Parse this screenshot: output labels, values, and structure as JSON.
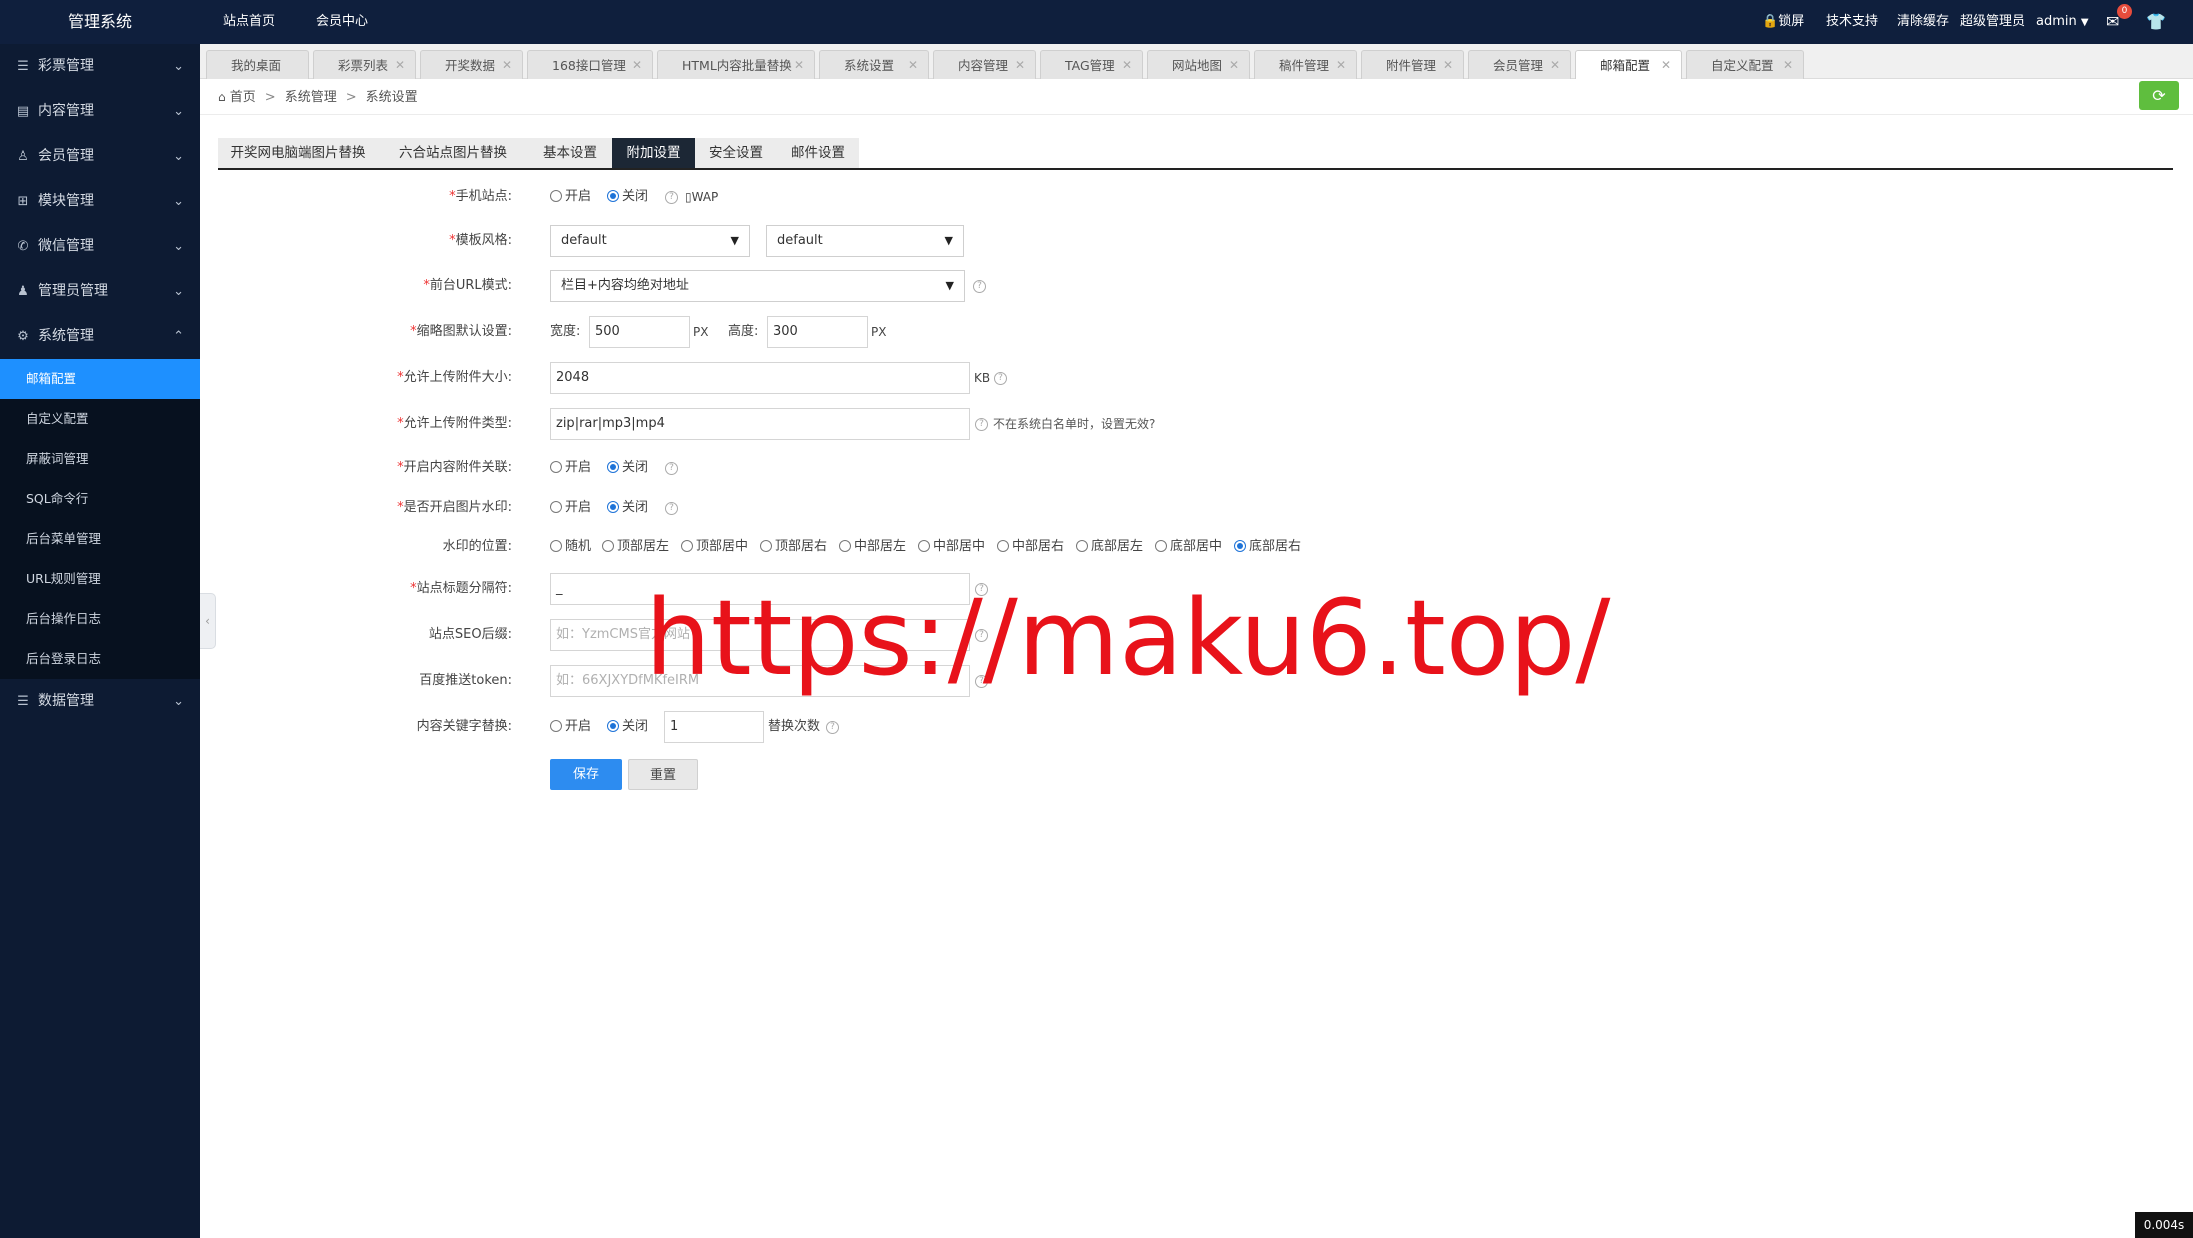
{
  "app": {
    "title": "管理系统"
  },
  "topnav": [
    "站点首页",
    "会员中心"
  ],
  "topright": {
    "lock": "锁屏",
    "support": "技术支持",
    "clear_cache": "清除缓存",
    "role": "超级管理员",
    "user": "admin",
    "mail_badge": "0"
  },
  "sidebar": {
    "groups": [
      "彩票管理",
      "内容管理",
      "会员管理",
      "模块管理",
      "微信管理",
      "管理员管理",
      "系统管理"
    ],
    "system_items": [
      "邮箱配置",
      "自定义配置",
      "屏蔽词管理",
      "SQL命令行",
      "后台菜单管理",
      "URL规则管理",
      "后台操作日志",
      "后台登录日志"
    ],
    "last_group": "数据管理"
  },
  "tabs": [
    "我的桌面",
    "彩票列表",
    "开奖数据",
    "168接口管理",
    "HTML内容批量替换",
    "系统设置",
    "内容管理",
    "TAG管理",
    "网站地图",
    "稿件管理",
    "附件管理",
    "会员管理",
    "邮箱配置",
    "自定义配置"
  ],
  "breadcrumb": [
    "首页",
    "系统管理",
    "系统设置"
  ],
  "subtabs": [
    "开奖网电脑端图片替换",
    "六合站点图片替换",
    "基本设置",
    "附加设置",
    "安全设置",
    "邮件设置"
  ],
  "form": {
    "mobile_site": {
      "label": "手机站点:",
      "on": "开启",
      "off": "关闭",
      "wap": "WAP"
    },
    "template": {
      "label": "模板风格:",
      "value1": "default",
      "value2": "default"
    },
    "url_mode": {
      "label": "前台URL模式:",
      "value": "栏目+内容均绝对地址"
    },
    "thumb": {
      "label": "缩略图默认设置:",
      "width_label": "宽度:",
      "width": "500",
      "height_label": "高度:",
      "height": "300",
      "unit": "PX"
    },
    "upload_size": {
      "label": "允许上传附件大小:",
      "value": "2048",
      "unit": "KB"
    },
    "upload_type": {
      "label": "允许上传附件类型:",
      "value": "zip|rar|mp3|mp4",
      "note": "不在系统白名单时，设置无效?"
    },
    "attach_link": {
      "label": "开启内容附件关联:",
      "on": "开启",
      "off": "关闭"
    },
    "watermark": {
      "label": "是否开启图片水印:",
      "on": "开启",
      "off": "关闭"
    },
    "wm_pos": {
      "label": "水印的位置:",
      "options": [
        "随机",
        "顶部居左",
        "顶部居中",
        "顶部居右",
        "中部居左",
        "中部居中",
        "中部居右",
        "底部居左",
        "底部居中",
        "底部居右"
      ]
    },
    "title_sep": {
      "label": "站点标题分隔符:",
      "value": "_"
    },
    "seo_suffix": {
      "label": "站点SEO后缀:",
      "placeholder": "如：YzmCMS官方网站"
    },
    "baidu_token": {
      "label": "百度推送token:",
      "placeholder": "如：66XJXYDfMKfeIRM"
    },
    "keyword_replace": {
      "label": "内容关键字替换:",
      "on": "开启",
      "off": "关闭",
      "count": "1",
      "count_label": "替换次数"
    },
    "save": "保存",
    "reset": "重置"
  },
  "overlay": {
    "watermark_url": "https://maku6.top/",
    "timer": "0.004s"
  }
}
